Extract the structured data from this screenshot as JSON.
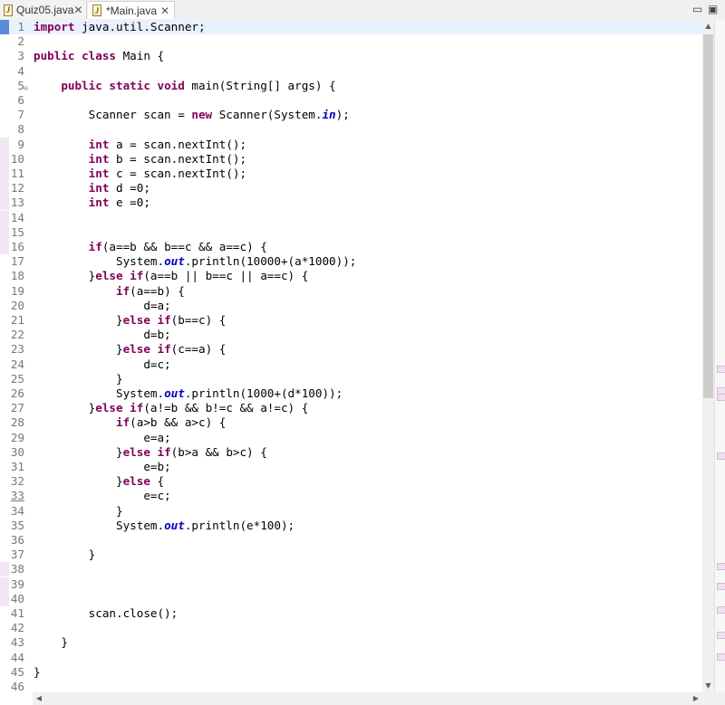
{
  "tabs": [
    {
      "label": "Quiz05.java",
      "icon": "java-file-icon",
      "close": "✕"
    },
    {
      "label": "*Main.java",
      "icon": "java-file-icon",
      "close": "✕"
    }
  ],
  "window_controls": {
    "minimize": "▭",
    "maximize": "▣"
  },
  "scroll_arrows": {
    "up": "▲",
    "down": "▼",
    "left": "◀",
    "right": "▶"
  },
  "current_line": 1,
  "lines": [
    {
      "n": "1",
      "html": "<span class='kw'>import</span> java.util.Scanner;"
    },
    {
      "n": "2",
      "html": ""
    },
    {
      "n": "3",
      "html": "<span class='kw'>public class</span> Main {"
    },
    {
      "n": "4",
      "html": ""
    },
    {
      "n": "5",
      "html": "    <span class='kw'>public static void</span> main(String[] args) {",
      "fold": true
    },
    {
      "n": "6",
      "html": ""
    },
    {
      "n": "7",
      "html": "        Scanner scan = <span class='kw'>new</span> Scanner(System.<span class='fld'>in</span>);"
    },
    {
      "n": "8",
      "html": ""
    },
    {
      "n": "9",
      "html": "        <span class='kw'>int</span> a = scan.nextInt();",
      "changed": true
    },
    {
      "n": "10",
      "html": "        <span class='kw'>int</span> b = scan.nextInt();",
      "changed": true
    },
    {
      "n": "11",
      "html": "        <span class='kw'>int</span> c = scan.nextInt();",
      "changed": true
    },
    {
      "n": "12",
      "html": "        <span class='kw'>int</span> d =0;",
      "changed": true
    },
    {
      "n": "13",
      "html": "        <span class='kw'>int</span> e =0;",
      "changed": true
    },
    {
      "n": "14",
      "html": "",
      "changed": true
    },
    {
      "n": "15",
      "html": "",
      "changed": true
    },
    {
      "n": "16",
      "html": "        <span class='kw'>if</span>(a==b &amp;&amp; b==c &amp;&amp; a==c) {",
      "changed": true
    },
    {
      "n": "17",
      "html": "            System.<span class='fld'>out</span>.println(10000+(a*1000));"
    },
    {
      "n": "18",
      "html": "        }<span class='kw'>else if</span>(a==b || b==c || a==c) {"
    },
    {
      "n": "19",
      "html": "            <span class='kw'>if</span>(a==b) {"
    },
    {
      "n": "20",
      "html": "                d=a;"
    },
    {
      "n": "21",
      "html": "            }<span class='kw'>else if</span>(b==c) {"
    },
    {
      "n": "22",
      "html": "                d=b;"
    },
    {
      "n": "23",
      "html": "            }<span class='kw'>else if</span>(c==a) {"
    },
    {
      "n": "24",
      "html": "                d=c;"
    },
    {
      "n": "25",
      "html": "            }"
    },
    {
      "n": "26",
      "html": "            System.<span class='fld'>out</span>.println(1000+(d*100));"
    },
    {
      "n": "27",
      "html": "        }<span class='kw'>else if</span>(a!=b &amp;&amp; b!=c &amp;&amp; a!=c) {"
    },
    {
      "n": "28",
      "html": "            <span class='kw'>if</span>(a&gt;b &amp;&amp; a&gt;c) {"
    },
    {
      "n": "29",
      "html": "                e=a;"
    },
    {
      "n": "30",
      "html": "            }<span class='kw'>else if</span>(b&gt;a &amp;&amp; b&gt;c) {"
    },
    {
      "n": "31",
      "html": "                e=b;"
    },
    {
      "n": "32",
      "html": "            }<span class='kw'>else</span> {"
    },
    {
      "n": "33",
      "html": "                e=c;",
      "underline": true
    },
    {
      "n": "34",
      "html": "            }"
    },
    {
      "n": "35",
      "html": "            System.<span class='fld'>out</span>.println(e*100);"
    },
    {
      "n": "36",
      "html": ""
    },
    {
      "n": "37",
      "html": "        }"
    },
    {
      "n": "38",
      "html": "",
      "changed": true
    },
    {
      "n": "39",
      "html": "",
      "changed": true
    },
    {
      "n": "40",
      "html": "",
      "changed": true
    },
    {
      "n": "41",
      "html": "        scan.close();"
    },
    {
      "n": "42",
      "html": ""
    },
    {
      "n": "43",
      "html": "    }"
    },
    {
      "n": "44",
      "html": ""
    },
    {
      "n": "45",
      "html": "}"
    },
    {
      "n": "46",
      "html": ""
    }
  ]
}
